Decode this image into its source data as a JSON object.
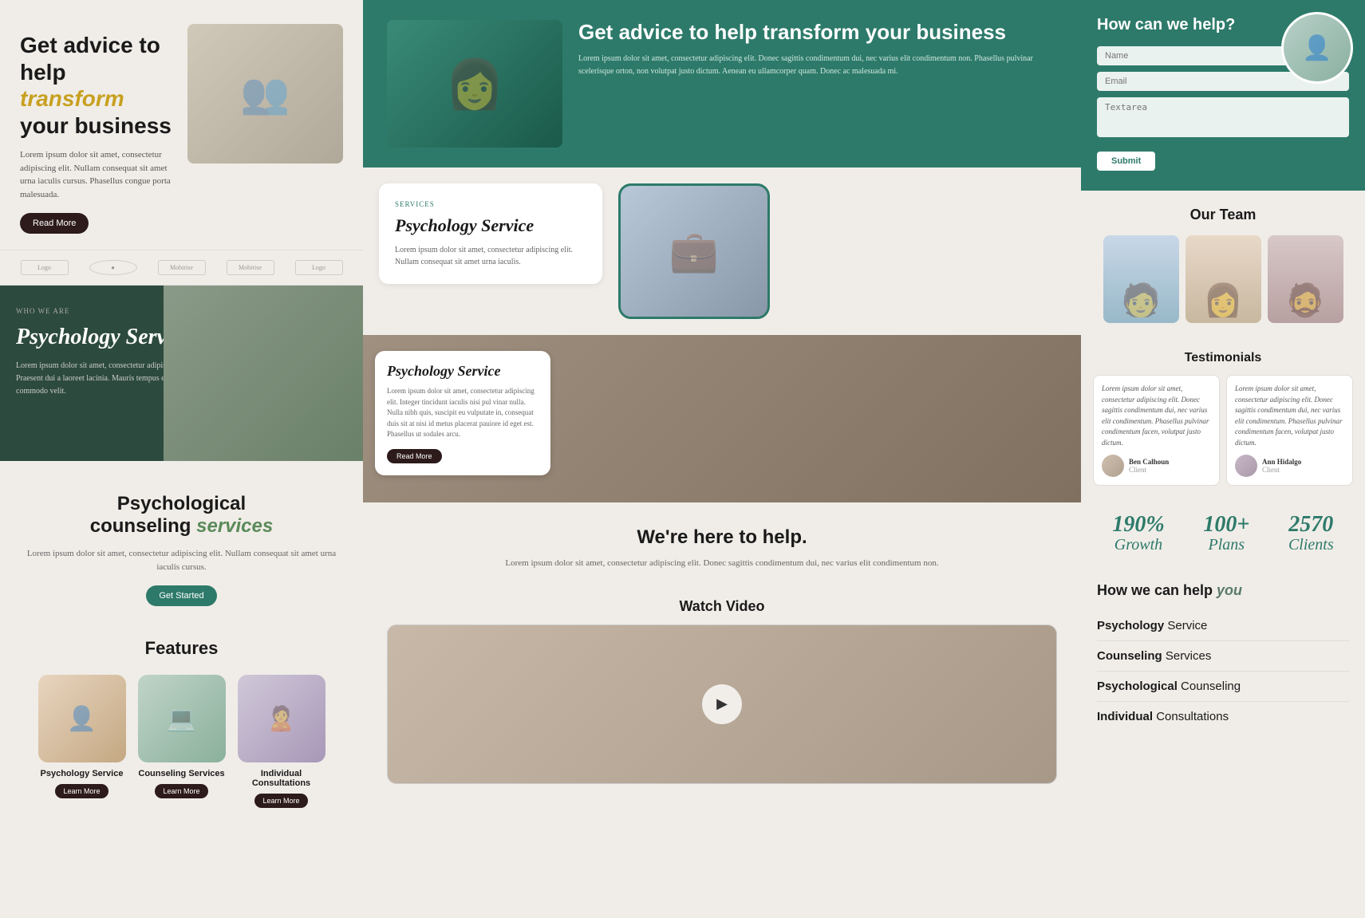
{
  "col1": {
    "hero": {
      "headline_pre": "Get ",
      "headline_bold": "advice",
      "headline_mid": " to help ",
      "headline_italic": "transform",
      "headline_post": " your business",
      "body": "Lorem ipsum dolor sit amet, consectetur adipiscing elit. Nullam consequat sit amet urna iaculis cursus. Phasellus congue porta malesuada.",
      "button_label": "Read More"
    },
    "logos": [
      "Logo 1",
      "Logo 2",
      "Mobirise",
      "Mobirise",
      "Logo 5"
    ],
    "psych_dark": {
      "who_we_are": "WHO WE ARE",
      "title": "Psychology Service",
      "body": "Lorem ipsum dolor sit amet, consectetur adipiscing elit. Praesent dui a laoreet lacinia. Mauris tempus erat nisl, et commodo velit."
    },
    "counseling": {
      "title_pre": "Psychological",
      "title_mid": "counseling ",
      "title_italic": "services",
      "body": "Lorem ipsum dolor sit amet, consectetur adipiscing elit. Nullam consequat sit amet urna iaculis cursus.",
      "button_label": "Get Started"
    },
    "features": {
      "title": "Features",
      "items": [
        {
          "name": "Psychology Service",
          "btn": "Learn More"
        },
        {
          "name": "Counseling Services",
          "btn": "Learn More"
        },
        {
          "name": "Individual Consultations",
          "btn": "Learn More"
        }
      ]
    }
  },
  "col2": {
    "hero_teal": {
      "title": "Get advice to help transform your business",
      "body": "Lorem ipsum dolor sit amet, consectetur adipiscing elit. Donec sagittis condimentum dui, nec varius elit condimentum non. Phasellus pulvinar scelerisque orton, non volutpat justo dictum. Aenean eu ullamcorper quam. Donec ac malesuada mi."
    },
    "service_card": {
      "label": "SERVICES",
      "title": "Psychology Service",
      "body": "Lorem ipsum dolor sit amet, consectetur adipiscing elit. Nullam consequat sit amet urna iaculis."
    },
    "psych_overlay": {
      "title": "Psychology Service",
      "body": "Lorem ipsum dolor sit amet, consectetur adipiscing elit. Integer tincidunt iaculis nisi pul vinar nulla. Nulla nibh quis, suscipit eu vulputate in, consequat duis sit at nisi id metus placerat pauiore id eget est. Phasellus ut sodales arcu.",
      "button": "Read More"
    },
    "help_section": {
      "title": "We're here to help.",
      "body": "Lorem ipsum dolor sit amet, consectetur adipiscing elit. Donec sagittis condimentum dui, nec varius elit condimentum non."
    },
    "watch_video": {
      "title": "Watch Video"
    }
  },
  "col3": {
    "form": {
      "title": "How can we help?",
      "name_placeholder": "Name",
      "email_placeholder": "Email",
      "textarea_placeholder": "Textarea",
      "submit_label": "Submit"
    },
    "team": {
      "title": "Our Team",
      "members": [
        "Member 1",
        "Member 2",
        "Member 3"
      ]
    },
    "testimonials": {
      "title": "Testimonials",
      "items": [
        {
          "text": "Lorem ipsum dolor sit amet, consectetur adipiscing elit. Donec sagittis condimentum dui, nec varius elit condimentum. Phasellus pulvinar condimentum facen, volutpat justo dictum.",
          "name": "Ben Calhoun",
          "role": "Client"
        },
        {
          "text": "Lorem ipsum dolor sit amet, consectetur adipiscing elit. Donec sagittis condimentum dui, nec varius elit condimentum. Phasellus pulvinar condimentum facen, volutpat justo dictum.",
          "name": "Ann Hidalgo",
          "role": "Client"
        }
      ]
    },
    "stats": [
      {
        "number": "190%",
        "label": "Growth"
      },
      {
        "number": "100+",
        "label": "Plans"
      },
      {
        "number": "2570",
        "label": "Clients"
      }
    ],
    "how_help": {
      "title_pre": "How we can help ",
      "title_accent": "you",
      "items": [
        {
          "bold": "Psychology ",
          "normal": "Service"
        },
        {
          "bold": "Counseling ",
          "normal": "Services"
        },
        {
          "bold": "Psychological ",
          "normal": "Counseling"
        },
        {
          "bold": "Individual ",
          "normal": "Consultations"
        }
      ]
    }
  }
}
